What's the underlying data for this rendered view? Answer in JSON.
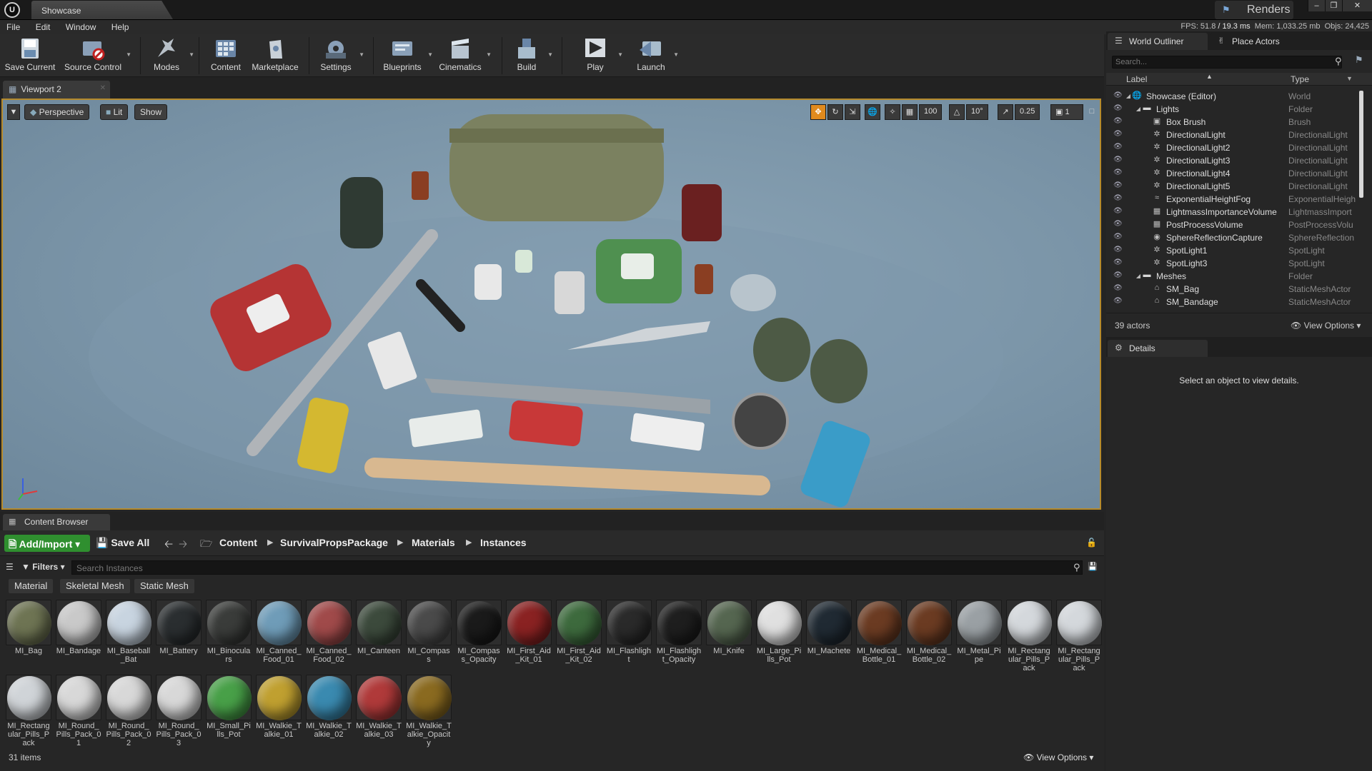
{
  "titlebar": {
    "logo": "U",
    "tab_title": "Showcase",
    "renders_label": "Renders",
    "controls": [
      "–",
      "❐",
      "✕"
    ]
  },
  "menu": [
    "File",
    "Edit",
    "Window",
    "Help"
  ],
  "stats": {
    "fps": "FPS: 51.8",
    "ms": "/ 19.3 ms",
    "mem": "Mem: 1,033.25 mb",
    "objs": "Objs: 24,425"
  },
  "toolbar": [
    {
      "label": "Save Current",
      "icon": "save-icon",
      "arrow": false
    },
    {
      "label": "Source Control",
      "icon": "source-control-icon",
      "arrow": true
    },
    {
      "label": "Modes",
      "icon": "modes-icon",
      "arrow": true
    },
    {
      "label": "Content",
      "icon": "content-icon",
      "arrow": false
    },
    {
      "label": "Marketplace",
      "icon": "marketplace-icon",
      "arrow": false
    },
    {
      "label": "Settings",
      "icon": "settings-icon",
      "arrow": true
    },
    {
      "label": "Blueprints",
      "icon": "blueprints-icon",
      "arrow": true
    },
    {
      "label": "Cinematics",
      "icon": "cinematics-icon",
      "arrow": true
    },
    {
      "label": "Build",
      "icon": "build-icon",
      "arrow": true
    },
    {
      "label": "Play",
      "icon": "play-icon",
      "arrow": true
    },
    {
      "label": "Launch",
      "icon": "launch-icon",
      "arrow": true
    }
  ],
  "viewport": {
    "tab": "Viewport 2",
    "perspective": "Perspective",
    "lit": "Lit",
    "show": "Show",
    "grid_snap": "100",
    "rot_snap": "10°",
    "scale_snap": "0.25",
    "cam_speed": "1"
  },
  "outliner": {
    "tab": "World Outliner",
    "place_tab": "Place Actors",
    "search_placeholder": "Search...",
    "col_label": "Label",
    "col_type": "Type",
    "rows": [
      {
        "label": "Showcase (Editor)",
        "type": "World",
        "icon": "world-icon"
      },
      {
        "label": "Lights",
        "type": "Folder",
        "icon": "folder-icon"
      },
      {
        "label": "Box Brush",
        "type": "Brush",
        "icon": "brush-icon"
      },
      {
        "label": "DirectionalLight",
        "type": "DirectionalLight",
        "icon": "light-icon"
      },
      {
        "label": "DirectionalLight2",
        "type": "DirectionalLight",
        "icon": "light-icon"
      },
      {
        "label": "DirectionalLight3",
        "type": "DirectionalLight",
        "icon": "light-icon"
      },
      {
        "label": "DirectionalLight4",
        "type": "DirectionalLight",
        "icon": "light-icon"
      },
      {
        "label": "DirectionalLight5",
        "type": "DirectionalLight",
        "icon": "light-icon"
      },
      {
        "label": "ExponentialHeightFog",
        "type": "ExponentialHeigh",
        "icon": "fog-icon"
      },
      {
        "label": "LightmassImportanceVolume",
        "type": "LightmassImport",
        "icon": "volume-icon"
      },
      {
        "label": "PostProcessVolume",
        "type": "PostProcessVolu",
        "icon": "volume-icon"
      },
      {
        "label": "SphereReflectionCapture",
        "type": "SphereReflection",
        "icon": "reflection-icon"
      },
      {
        "label": "SpotLight1",
        "type": "SpotLight",
        "icon": "spotlight-icon"
      },
      {
        "label": "SpotLight3",
        "type": "SpotLight",
        "icon": "spotlight-icon"
      },
      {
        "label": "Meshes",
        "type": "Folder",
        "icon": "folder-icon"
      },
      {
        "label": "SM_Bag",
        "type": "StaticMeshActor",
        "icon": "mesh-icon"
      },
      {
        "label": "SM_Bandage",
        "type": "StaticMeshActor",
        "icon": "mesh-icon"
      }
    ],
    "actor_count": "39 actors",
    "view_options": "View Options"
  },
  "details": {
    "tab": "Details",
    "empty_text": "Select an object to view details."
  },
  "content_browser": {
    "tab": "Content Browser",
    "add_import": "Add/Import",
    "save_all": "Save All",
    "path": [
      "Content",
      "SurvivalPropsPackage",
      "Materials",
      "Instances"
    ],
    "filters": "Filters",
    "search_placeholder": "Search Instances",
    "filter_chips": [
      "Material",
      "Skeletal Mesh",
      "Static Mesh"
    ],
    "assets": [
      {
        "name": "MI_Bag",
        "color": "#6e7453"
      },
      {
        "name": "MI_Bandage",
        "color": "#c9c9c9"
      },
      {
        "name": "MI_Baseball_Bat",
        "color": "#c8d4e0"
      },
      {
        "name": "MI_Battery",
        "color": "#2a2e30"
      },
      {
        "name": "MI_Binoculars",
        "color": "#3a3c3a"
      },
      {
        "name": "MI_Canned_Food_01",
        "color": "#6f9cb8"
      },
      {
        "name": "MI_Canned_Food_02",
        "color": "#a04a4a"
      },
      {
        "name": "MI_Canteen",
        "color": "#3c4a3c"
      },
      {
        "name": "MI_Compass",
        "color": "#4a4a4a"
      },
      {
        "name": "MI_Compass_Opacity",
        "color": "#1a1a1a"
      },
      {
        "name": "MI_First_Aid_Kit_01",
        "color": "#8a2222"
      },
      {
        "name": "MI_First_Aid_Kit_02",
        "color": "#3d6a3d"
      },
      {
        "name": "MI_Flashlight",
        "color": "#2a2a2a"
      },
      {
        "name": "MI_Flashlight_Opacity",
        "color": "#1e1e1e"
      },
      {
        "name": "MI_Knife",
        "color": "#556650"
      },
      {
        "name": "MI_Large_Pills_Pot",
        "color": "#e0e0e0"
      },
      {
        "name": "MI_Machete",
        "color": "#202a33"
      },
      {
        "name": "MI_Medical_Bottle_01",
        "color": "#6b3b22"
      },
      {
        "name": "MI_Medical_Bottle_02",
        "color": "#6b3b22"
      },
      {
        "name": "MI_Metal_Pipe",
        "color": "#9aa0a4"
      },
      {
        "name": "MI_Rectangular_Pills_Pack",
        "color": "#d4d8dc"
      },
      {
        "name": "MI_Rectangular_Pills_Pack",
        "color": "#d4d8dc"
      },
      {
        "name": "MI_Rectangular_Pills_Pack",
        "color": "#d0d4d8"
      },
      {
        "name": "MI_Round_Pills_Pack_01",
        "color": "#d8d8d8"
      },
      {
        "name": "MI_Round_Pills_Pack_02",
        "color": "#d8d8d8"
      },
      {
        "name": "MI_Round_Pills_Pack_03",
        "color": "#d8d8d8"
      },
      {
        "name": "MI_Small_Pills_Pot",
        "color": "#48a048"
      },
      {
        "name": "MI_Walkie_Talkie_01",
        "color": "#c0a030"
      },
      {
        "name": "MI_Walkie_Talkie_02",
        "color": "#3a8ab0"
      },
      {
        "name": "MI_Walkie_Talkie_03",
        "color": "#b03a3a"
      },
      {
        "name": "MI_Walkie_Talkie_Opacity",
        "color": "#8a6a20"
      }
    ],
    "item_count": "31 items",
    "view_options": "View Options"
  }
}
